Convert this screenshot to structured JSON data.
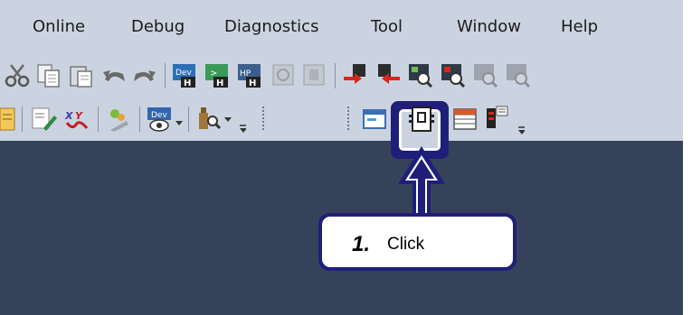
{
  "menubar": {
    "items": [
      "Online",
      "Debug",
      "Diagnostics",
      "Tool",
      "Window",
      "Help"
    ]
  },
  "toolbar1": {
    "icons": [
      "cut-icon",
      "copy-icon",
      "paste-icon",
      "undo-icon",
      "redo-icon",
      "device-read-icon",
      "device-write-icon",
      "device-verify-icon",
      "disabled-icon",
      "disabled-icon",
      "transfer-red-icon",
      "transfer-red-icon",
      "search-green-icon",
      "search-red-icon",
      "search-gray-icon",
      "search-gray-icon"
    ]
  },
  "toolbar2": {
    "icons": [
      "program-icon",
      "edit-icon",
      "check-icon",
      "wizard-icon",
      "device-monitor-icon",
      "probe-icon",
      "label-icon",
      "module-config-icon",
      "list-icon",
      "parameter-icon"
    ]
  },
  "callout": {
    "step": "1.",
    "text": "Click"
  },
  "colors": {
    "toolbar_bg": "#cbd3e0",
    "workspace_bg": "#36425a",
    "highlight": "#1f1f7a"
  }
}
